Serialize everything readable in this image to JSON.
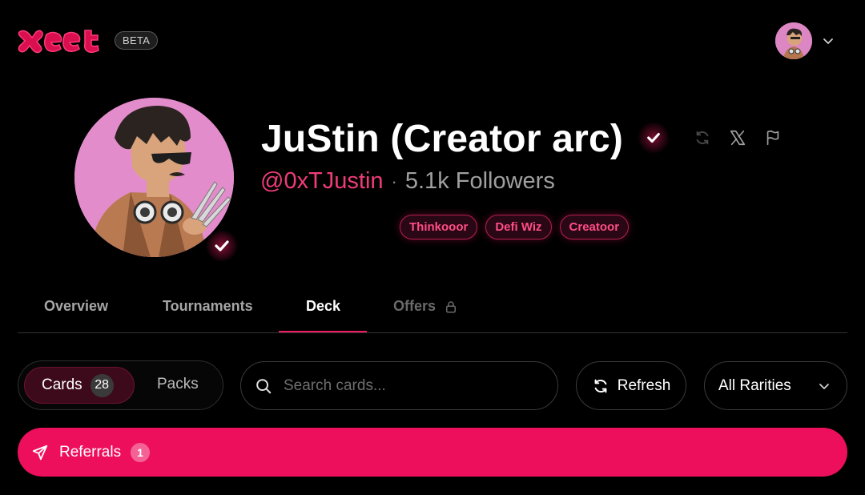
{
  "header": {
    "logo_text": "xeet",
    "beta_label": "BETA"
  },
  "profile": {
    "name": "JuStin (Creator arc)",
    "handle": "@0xTJustin",
    "separator": "·",
    "followers": "5.1k Followers",
    "tags": [
      "Thinkooor",
      "Defi Wiz",
      "Creatoor"
    ],
    "accent_color": "#ee1b5f"
  },
  "tabs": [
    {
      "label": "Overview",
      "active": false
    },
    {
      "label": "Tournaments",
      "active": false
    },
    {
      "label": "Deck",
      "active": true
    },
    {
      "label": "Offers",
      "active": false,
      "locked": true
    }
  ],
  "controls": {
    "cards_label": "Cards",
    "cards_count": "28",
    "packs_label": "Packs",
    "search_placeholder": "Search cards...",
    "refresh_label": "Refresh",
    "rarity_selected": "All Rarities"
  },
  "referrals": {
    "label": "Referrals",
    "count": "1"
  },
  "icons": {
    "verified": "check-badge-icon",
    "sync": "refresh-icon",
    "x": "x-logo-icon",
    "flag": "flag-icon",
    "lock": "lock-icon",
    "search": "search-icon",
    "send": "send-icon",
    "chevron": "chevron-down-icon"
  }
}
